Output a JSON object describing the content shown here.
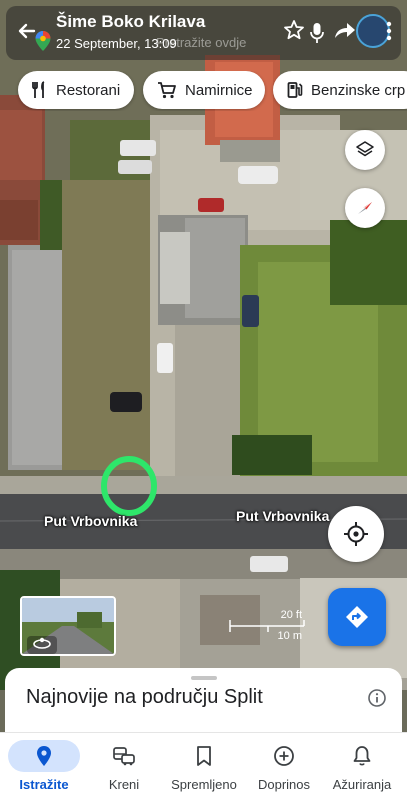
{
  "place": {
    "title": "Šime Boko Krilava",
    "datetime": "22 September, 13:09",
    "search_placeholder": "Pretražite ovdje"
  },
  "chips": [
    {
      "label": "Restorani",
      "icon": "restaurant-icon"
    },
    {
      "label": "Namirnice",
      "icon": "cart-icon"
    },
    {
      "label": "Benzinske crp",
      "icon": "gas-station-icon"
    }
  ],
  "map": {
    "road_label_left": "Put Vrbovnika",
    "road_label_right": "Put Vrbovnika",
    "scale_ft": "20 ft",
    "scale_m": "10 m",
    "highlight_color": "#2ee66a"
  },
  "sheet": {
    "heading": "Najnovije na području Split"
  },
  "nav": [
    {
      "label": "Istražite",
      "icon": "location-pin-icon",
      "active": true
    },
    {
      "label": "Kreni",
      "icon": "commute-icon",
      "active": false
    },
    {
      "label": "Spremljeno",
      "icon": "bookmark-icon",
      "active": false
    },
    {
      "label": "Doprinos",
      "icon": "add-circle-icon",
      "active": false
    },
    {
      "label": "Ažuriranja",
      "icon": "bell-icon",
      "active": false
    }
  ],
  "colors": {
    "accent": "#1a73e8",
    "nav_active": "#0b57d0",
    "nav_active_bg": "#d3e3fd"
  }
}
